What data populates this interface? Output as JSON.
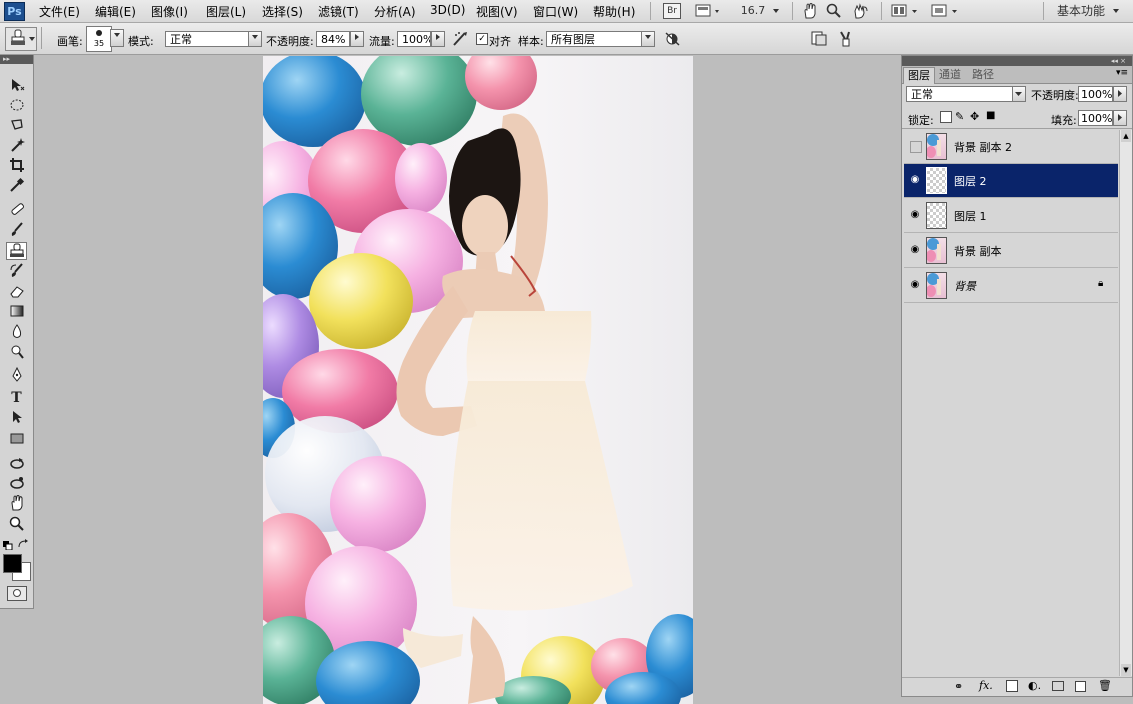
{
  "menubar": {
    "logo": "Ps",
    "items": [
      {
        "label": "文件(E)"
      },
      {
        "label": "编辑(E)"
      },
      {
        "label": "图像(I)"
      },
      {
        "label": "图层(L)"
      },
      {
        "label": "选择(S)"
      },
      {
        "label": "滤镜(T)"
      },
      {
        "label": "分析(A)"
      },
      {
        "label": "3D(D)"
      },
      {
        "label": "视图(V)"
      },
      {
        "label": "窗口(W)"
      },
      {
        "label": "帮助(H)"
      }
    ],
    "bridge_label": "Br",
    "zoom": "16.7",
    "workspace": "基本功能"
  },
  "options": {
    "brush_label": "画笔:",
    "brush_size": "35",
    "mode_label": "模式:",
    "mode_value": "正常",
    "opacity_label": "不透明度:",
    "opacity_value": "84%",
    "flow_label": "流量:",
    "flow_value": "100%",
    "aligned_label": "对齐",
    "sample_label": "样本:",
    "sample_value": "所有图层"
  },
  "layers_panel": {
    "tabs": [
      {
        "label": "图层"
      },
      {
        "label": "通道"
      },
      {
        "label": "路径"
      }
    ],
    "blend_mode": "正常",
    "opacity_label": "不透明度:",
    "opacity_value": "100%",
    "lock_label": "锁定:",
    "fill_label": "填充:",
    "fill_value": "100%",
    "layers": [
      {
        "name": "背景 副本 2",
        "visible": false,
        "selected": false
      },
      {
        "name": "图层 2",
        "visible": true,
        "selected": true
      },
      {
        "name": "图层 1",
        "visible": true,
        "selected": false
      },
      {
        "name": "背景 副本",
        "visible": true,
        "selected": false
      },
      {
        "name": "背景",
        "visible": true,
        "selected": false,
        "locked": true
      }
    ]
  },
  "colors": {
    "foreground": "#000000",
    "background": "#ffffff",
    "selection": "#0a246a"
  }
}
